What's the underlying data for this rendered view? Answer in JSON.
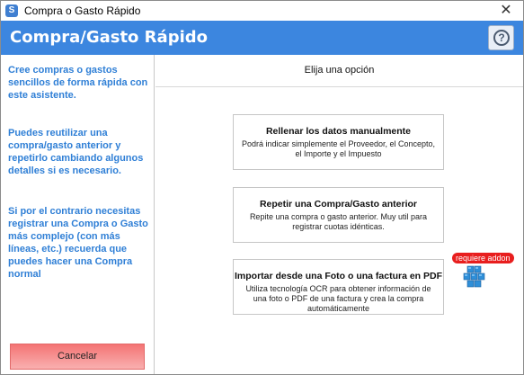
{
  "window": {
    "title": "Compra o Gasto Rápido",
    "close_glyph": "✕"
  },
  "header": {
    "title": "Compra/Gasto Rápido",
    "help_glyph": "?"
  },
  "sidebar": {
    "paragraphs": [
      "Cree compras o gastos sencillos de forma rápida con este asistente.",
      "Puedes reutilizar una compra/gasto anterior y repetirlo cambiando algunos detalles si es necesario.",
      "Si por el contrario necesitas registrar una Compra o Gasto más complejo (con más líneas, etc.) recuerda que puedes hacer una Compra normal"
    ],
    "cancel_label": "Cancelar"
  },
  "main": {
    "heading": "Elija una opción",
    "options": [
      {
        "title": "Rellenar los datos manualmente",
        "description": "Podrá indicar simplemente el Proveedor, el Concepto, el Importe y el Impuesto"
      },
      {
        "title": "Repetir una Compra/Gasto anterior",
        "description": "Repite una compra o gasto anterior. Muy util para registrar cuotas idénticas."
      },
      {
        "title": "Importar desde una Foto o una factura en PDF",
        "description": "Utiliza tecnología OCR para obtener información de una foto o PDF de una factura y crea la compra automáticamente"
      }
    ],
    "addon_badge": "requiere addon"
  },
  "colors": {
    "header_bg": "#3c86df",
    "sidebar_text": "#2f7fd6",
    "cancel_bg": "#f47474",
    "badge_bg": "#e81e1e"
  },
  "icons": {
    "app": "app-logo-icon",
    "help": "help-icon",
    "addon": "cubes-addon-icon"
  }
}
